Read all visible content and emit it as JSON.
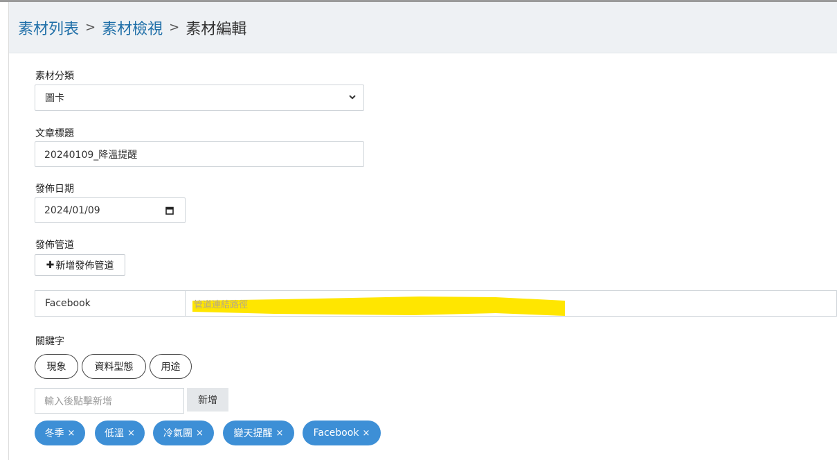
{
  "breadcrumb": {
    "items": [
      {
        "label": "素材列表"
      },
      {
        "label": "素材檢視"
      },
      {
        "label": "素材編輯"
      }
    ],
    "separator": ">"
  },
  "form": {
    "category": {
      "label": "素材分類",
      "value": "圖卡"
    },
    "title": {
      "label": "文章標題",
      "value": "20240109_降溫提醒"
    },
    "publish_date": {
      "label": "發佈日期",
      "value": "2024/01/09"
    },
    "channels": {
      "label": "發佈管道",
      "add_button": "新增發佈管道",
      "rows": [
        {
          "name": "Facebook",
          "url_placeholder": "管道連結路徑"
        }
      ]
    },
    "keywords": {
      "label": "關鍵字",
      "suggestions": [
        "現象",
        "資料型態",
        "用途"
      ],
      "input_placeholder": "輸入後點擊新增",
      "add_button": "新增",
      "selected": [
        "冬季",
        "低溫",
        "冷氣團",
        "變天提醒",
        "Facebook"
      ],
      "remove_symbol": "×"
    }
  },
  "colors": {
    "link": "#1f6fa8",
    "chip": "#3d8fd6",
    "header_bg": "#eef1f4",
    "highlight": "#ffe600"
  }
}
